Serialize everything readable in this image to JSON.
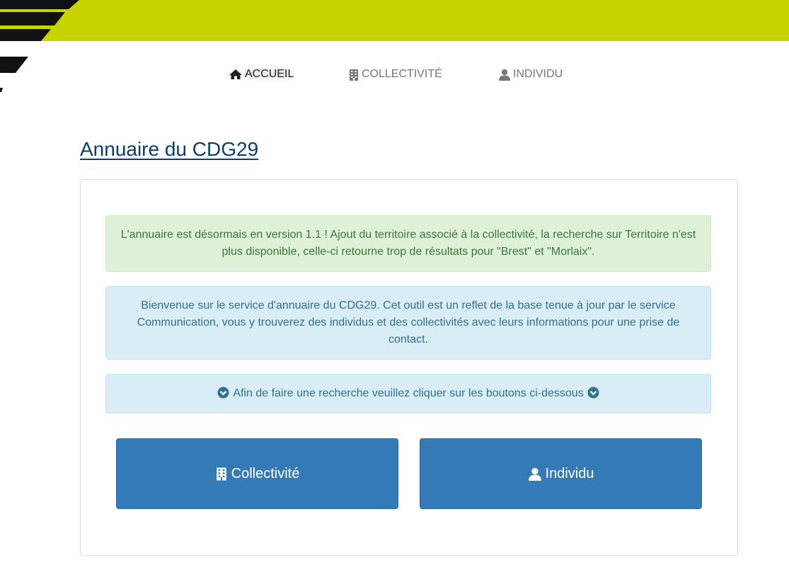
{
  "nav": {
    "items": [
      {
        "label": "ACCUEIL",
        "icon": "home-icon",
        "active": true
      },
      {
        "label": "COLLECTIVITÉ",
        "icon": "building-icon",
        "active": false
      },
      {
        "label": "INDIVIDU",
        "icon": "user-icon",
        "active": false
      }
    ]
  },
  "page": {
    "title": "Annuaire du CDG29"
  },
  "alerts": {
    "success_text": "L'annuaire est désormais en version 1.1 ! Ajout du territoire associé à la collectivité, la recherche sur Territoire n'est plus disponible, celle-ci retourne trop de résultats pour \"Brest\" et \"Morlaix\".",
    "welcome_text": "Bienvenue sur le service d'annuaire du CDG29. Cet outil est un reflet de la base tenue à jour par le service Communication, vous y trouverez des individus et des collectivités avec leurs informations pour une prise de contact.",
    "search_hint_text": "Afin de faire une recherche veuillez cliquer sur les boutons ci-dessous"
  },
  "buttons": {
    "collectivite_label": "Collectivité",
    "individu_label": "Individu"
  },
  "colors": {
    "banner": "#c8d400",
    "primary": "#337ab7",
    "success_bg": "#dff0d8",
    "info_bg": "#d9edf7",
    "title": "#0b3d6e"
  }
}
